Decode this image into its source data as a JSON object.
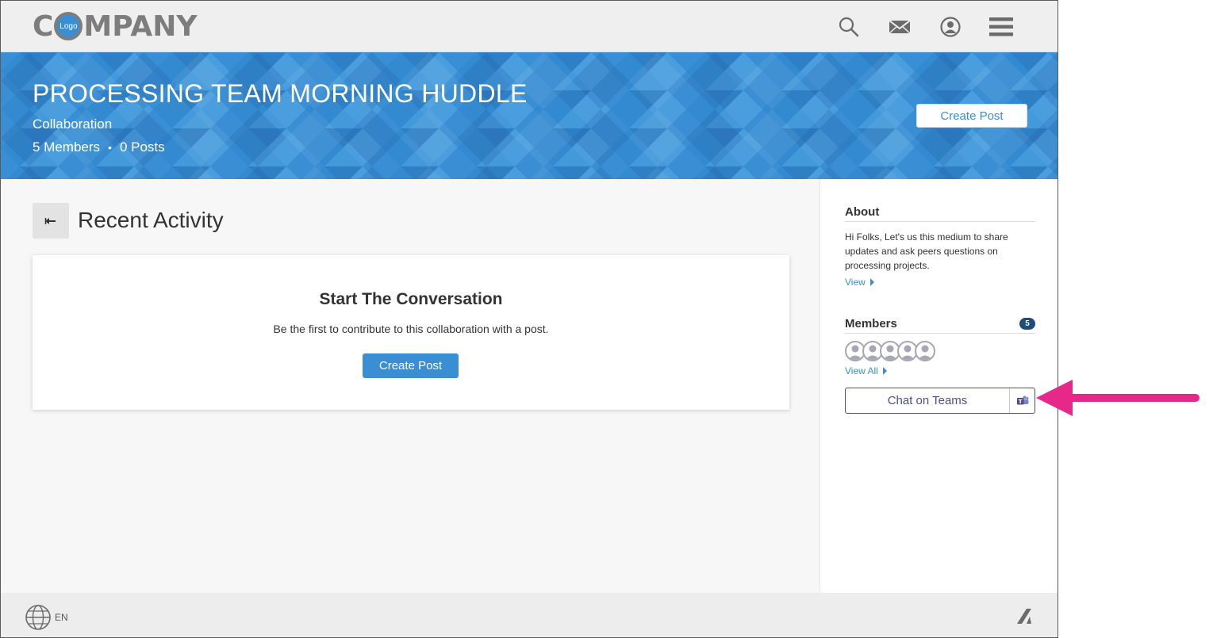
{
  "header": {
    "logo_prefix": "C",
    "logo_badge": "Logo",
    "logo_suffix": "MPANY",
    "icons": [
      "search-icon",
      "mail-icon",
      "user-icon",
      "menu-icon"
    ]
  },
  "banner": {
    "title": "PROCESSING TEAM MORNING HUDDLE",
    "subtitle": "Collaboration",
    "members": "5 Members",
    "separator": "•",
    "posts": "0 Posts",
    "create_post_label": "Create Post"
  },
  "main": {
    "section_title": "Recent Activity",
    "card": {
      "title": "Start The Conversation",
      "text": "Be the first to contribute to this collaboration with a post.",
      "button_label": "Create Post"
    }
  },
  "sidebar": {
    "about": {
      "heading": "About",
      "text": "Hi Folks, Let's us this medium to share updates and ask peers questions on processing projects.",
      "link": "View"
    },
    "members": {
      "heading": "Members",
      "count": "5",
      "link": "View All"
    },
    "teams_button_label": "Chat on Teams"
  },
  "footer": {
    "language": "EN"
  },
  "colors": {
    "accent": "#3a8fd4",
    "teams": "#4b4f8c",
    "annotation": "#e8278a"
  }
}
